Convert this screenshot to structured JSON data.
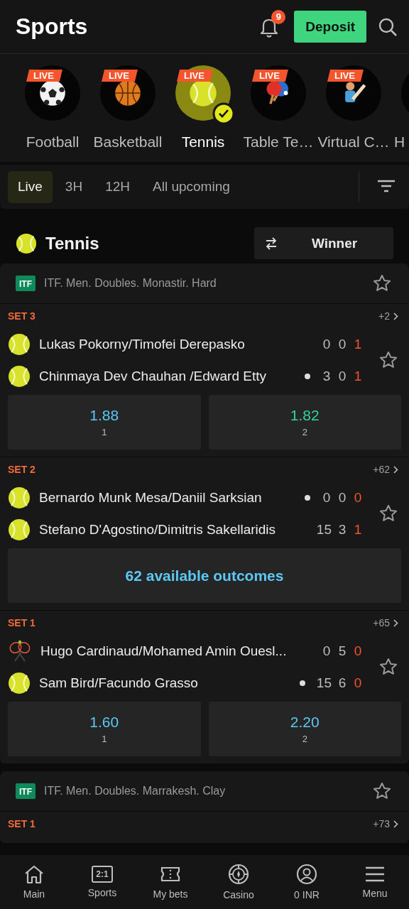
{
  "header": {
    "title": "Sports",
    "notifications": "9",
    "deposit": "Deposit"
  },
  "sports": [
    {
      "label": "Football",
      "kind": "soccer",
      "badge": "LIVE",
      "selected": false
    },
    {
      "label": "Basketball",
      "kind": "basketball",
      "badge": "LIVE",
      "selected": false
    },
    {
      "label": "Tennis",
      "kind": "tennis",
      "badge": "LIVE",
      "selected": true
    },
    {
      "label": "Table Te…",
      "kind": "pingpong",
      "badge": "LIVE",
      "selected": false
    },
    {
      "label": "Virtual C…",
      "kind": "cricket",
      "badge": "LIVE",
      "selected": false
    },
    {
      "label": "H",
      "kind": "other",
      "selected": false
    }
  ],
  "filters": [
    {
      "label": "Live",
      "selected": true
    },
    {
      "label": "3H",
      "selected": false
    },
    {
      "label": "12H",
      "selected": false
    },
    {
      "label": "All upcoming",
      "selected": false
    }
  ],
  "section": {
    "title": "Tennis",
    "market": "Winner"
  },
  "leagues": [
    {
      "title": "ITF. Men. Doubles. Monastir. Hard",
      "logo": "ITF",
      "matches": [
        {
          "period": "SET 3",
          "more": "+2",
          "teams": [
            {
              "name": "Lukas Pokorny/Timofei Derepasko",
              "kind": "ball",
              "serving": false,
              "scores": [
                "0",
                "0",
                "1"
              ]
            },
            {
              "name": "Chinmaya Dev Chauhan /Edward Etty",
              "kind": "ball",
              "serving": true,
              "scores": [
                "3",
                "0",
                "1"
              ]
            }
          ],
          "kind": "odds",
          "odds": [
            {
              "value": "1.88",
              "label": "1",
              "color": "#5bc8f5"
            },
            {
              "value": "1.82",
              "label": "2",
              "color": "#2fd69a"
            }
          ]
        },
        {
          "period": "SET 2",
          "more": "+62",
          "teams": [
            {
              "name": "Bernardo Munk Mesa/Daniil Sarksian",
              "kind": "ball",
              "serving": true,
              "scores": [
                "0",
                "0",
                "0"
              ]
            },
            {
              "name": "Stefano D'Agostino/Dimitris Sakellaridis",
              "kind": "ball",
              "serving": false,
              "scores": [
                "15",
                "3",
                "1"
              ]
            }
          ],
          "kind": "outcomes",
          "outcomes": "62 available outcomes"
        },
        {
          "period": "SET 1",
          "more": "+65",
          "teams": [
            {
              "name": "Hugo Cardinaud/Mohamed Amin Ouesl...",
              "kind": "rackets",
              "serving": false,
              "scores": [
                "0",
                "5",
                "0"
              ]
            },
            {
              "name": "Sam Bird/Facundo Grasso",
              "kind": "ball",
              "serving": true,
              "scores": [
                "15",
                "6",
                "0"
              ]
            }
          ],
          "kind": "odds",
          "odds": [
            {
              "value": "1.60",
              "label": "1",
              "color": "#5bc8f5"
            },
            {
              "value": "2.20",
              "label": "2",
              "color": "#5bc8f5"
            }
          ]
        }
      ]
    },
    {
      "title": "ITF. Men. Doubles. Marrakesh. Clay",
      "logo": "ITF",
      "matches": [
        {
          "period": "SET 1",
          "more": "+73",
          "kind": "none"
        }
      ]
    }
  ],
  "nav": [
    {
      "label": "Main",
      "kind": "home"
    },
    {
      "label": "Sports",
      "kind": "sports",
      "badge": "2:1"
    },
    {
      "label": "My bets",
      "kind": "ticket"
    },
    {
      "label": "Casino",
      "kind": "chip"
    },
    {
      "label": "0 INR",
      "kind": "user"
    },
    {
      "label": "Menu",
      "kind": "menu"
    }
  ]
}
